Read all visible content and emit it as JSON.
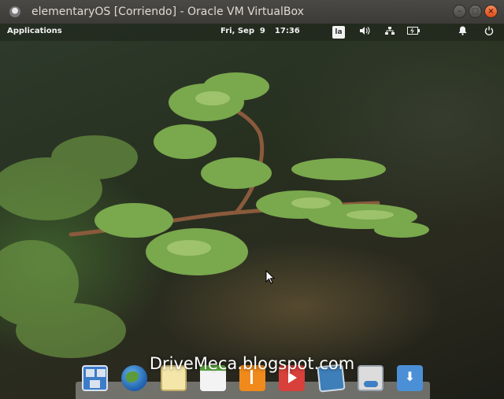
{
  "window": {
    "title": "elementaryOS [Corriendo] - Oracle VM VirtualBox",
    "icon": "virtualbox-icon"
  },
  "panel": {
    "applications_label": "Applications",
    "date": "Fri, Sep  9",
    "time": "17:36",
    "keyboard_layout": "la",
    "indicators": [
      "sound-icon",
      "network-icon",
      "power-icon",
      "notifications-icon",
      "shutdown-icon"
    ]
  },
  "dock": {
    "items": [
      "multitasking-view",
      "web-browser",
      "mail",
      "calendar",
      "music",
      "videos",
      "photos",
      "system-settings",
      "appcenter"
    ]
  },
  "watermark": "DriveMeca.blogspot.com"
}
